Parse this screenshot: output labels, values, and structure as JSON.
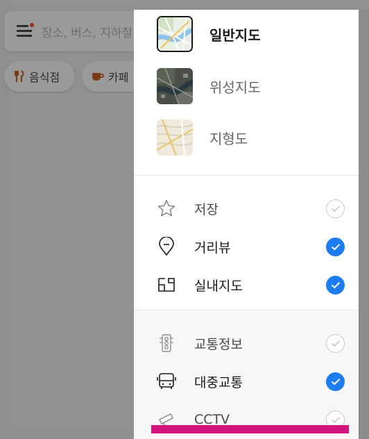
{
  "search": {
    "placeholder": "장소, 버스, 지하철"
  },
  "chips": [
    {
      "label": "음식점",
      "icon": "fork-knife-icon"
    },
    {
      "label": "카페",
      "icon": "coffee-cup-icon"
    }
  ],
  "map_types": [
    {
      "label": "일반지도",
      "selected": true
    },
    {
      "label": "위성지도",
      "selected": false
    },
    {
      "label": "지형도",
      "selected": false
    }
  ],
  "layers": [
    {
      "label": "저장",
      "icon": "star-icon",
      "checked": false
    },
    {
      "label": "거리뷰",
      "icon": "location-pin-icon",
      "checked": true
    },
    {
      "label": "실내지도",
      "icon": "floorplan-icon",
      "checked": true
    },
    {
      "label": "교통정보",
      "icon": "traffic-light-icon",
      "checked": false
    },
    {
      "label": "대중교통",
      "icon": "bus-icon",
      "checked": true
    },
    {
      "label": "CCTV",
      "icon": "cctv-icon",
      "checked": false
    }
  ],
  "colors": {
    "check_on": "#1e7cf2",
    "check_off_border": "#c8c8c8",
    "accent_bar": "#d4147e",
    "overlay": "#8f8f8f"
  }
}
